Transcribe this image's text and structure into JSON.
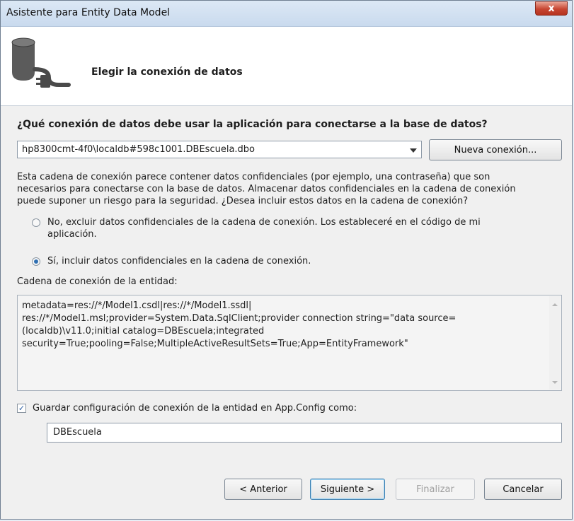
{
  "window": {
    "title": "Asistente para Entity Data Model",
    "close_label": "x"
  },
  "header": {
    "title": "Elegir la conexión de datos",
    "icon": "database-connection-icon"
  },
  "question": "¿Qué conexión de datos debe usar la aplicación para conectarse a la base de datos?",
  "connection": {
    "selected": "hp8300cmt-4f0\\localdb#598c1001.DBEscuela.dbo",
    "new_button": "Nueva conexión..."
  },
  "warning": {
    "line1": "Esta cadena de conexión parece contener datos confidenciales (por ejemplo, una contraseña) que son",
    "line2": "necesarios para conectarse con la base de datos. Almacenar datos confidenciales en la cadena de conexión",
    "line3": "puede suponer un riesgo para la seguridad. ¿Desea incluir estos datos en la cadena de conexión?"
  },
  "options": {
    "no_line1": "No, excluir datos confidenciales de la cadena de conexión. Los estableceré en el código de mi",
    "no_line2": "aplicación.",
    "yes": "Sí, incluir datos confidenciales en la cadena de conexión.",
    "selected": "yes"
  },
  "entity": {
    "label": "Cadena de conexión de la entidad:",
    "line1": "metadata=res://*/Model1.csdl|res://*/Model1.ssdl|",
    "line2": "res://*/Model1.msl;provider=System.Data.SqlClient;provider connection string=\"data source=",
    "line3": "(localdb)\\v11.0;initial catalog=DBEscuela;integrated",
    "line4": "security=True;pooling=False;MultipleActiveResultSets=True;App=EntityFramework\""
  },
  "save": {
    "checked": true,
    "label": "Guardar configuración de conexión de la entidad en App.Config como:",
    "name": "DBEscuela"
  },
  "buttons": {
    "previous": "< Anterior",
    "next": "Siguiente >",
    "finish": "Finalizar",
    "cancel": "Cancelar"
  }
}
